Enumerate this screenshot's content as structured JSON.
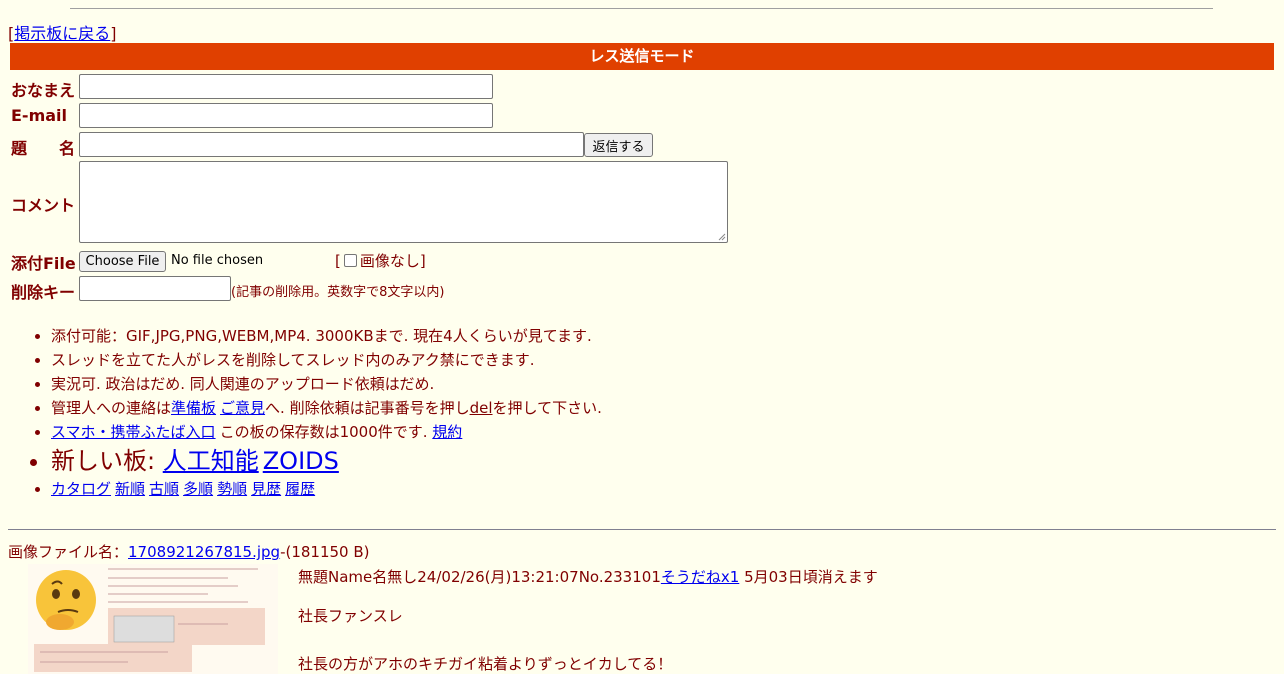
{
  "back": {
    "open": "[",
    "link": "掲示板に戻る",
    "close": "]"
  },
  "mode_bar": "レス送信モード",
  "form": {
    "name_label": "おなまえ",
    "email_label": "E-mail",
    "subject_label": "題　　名",
    "submit_label": "返信する",
    "comment_label": "コメント",
    "file_label": "添付File",
    "choose_file": "Choose File",
    "no_file": "No file chosen",
    "no_image": "画像なし",
    "delkey_label": "削除キー",
    "delkey_note": "(記事の削除用。英数字で8文字以内)"
  },
  "notes": {
    "n1": "添付可能：GIF,JPG,PNG,WEBM,MP4. 3000KBまで. 現在4人くらいが見てます.",
    "n2": "スレッドを立てた人がレスを削除してスレッド内のみアク禁にできます.",
    "n3": "実況可. 政治はだめ. 同人関連のアップロード依頼はだめ.",
    "n4_pre": "管理人への連絡は",
    "n4_link1": "準備板",
    "n4_link2": "ご意見",
    "n4_mid": "へ. 削除依頼は記事番号を押し",
    "n4_del": "del",
    "n4_post": "を押して下さい.",
    "n5_link": "スマホ・携帯ふたば入口",
    "n5_mid": "この板の保存数は1000件です.",
    "n5_rules": "規約",
    "new_boards_label": "新しい板:",
    "new_board1": "人工知能",
    "new_board2": "ZOIDS",
    "sort_links": [
      "カタログ",
      "新順",
      "古順",
      "多順",
      "勢順",
      "見歴",
      "履歴"
    ]
  },
  "post": {
    "file_label": "画像ファイル名：",
    "file_name": "1708921267815.jpg",
    "file_size": "-(181150 B)",
    "header": "無題Name名無し24/02/26(月)13:21:07No.233101",
    "soudane": "そうだねx1",
    "expire": "5月03日頃消えます",
    "body_line1": "社長ファンスレ",
    "body_line2": "社長の方がアホのキチガイ粘着よりずっとイカしてる！"
  },
  "colors": {
    "background": "#ffffee",
    "text": "#800000",
    "bar": "#e04000",
    "link": "#0000ee"
  }
}
